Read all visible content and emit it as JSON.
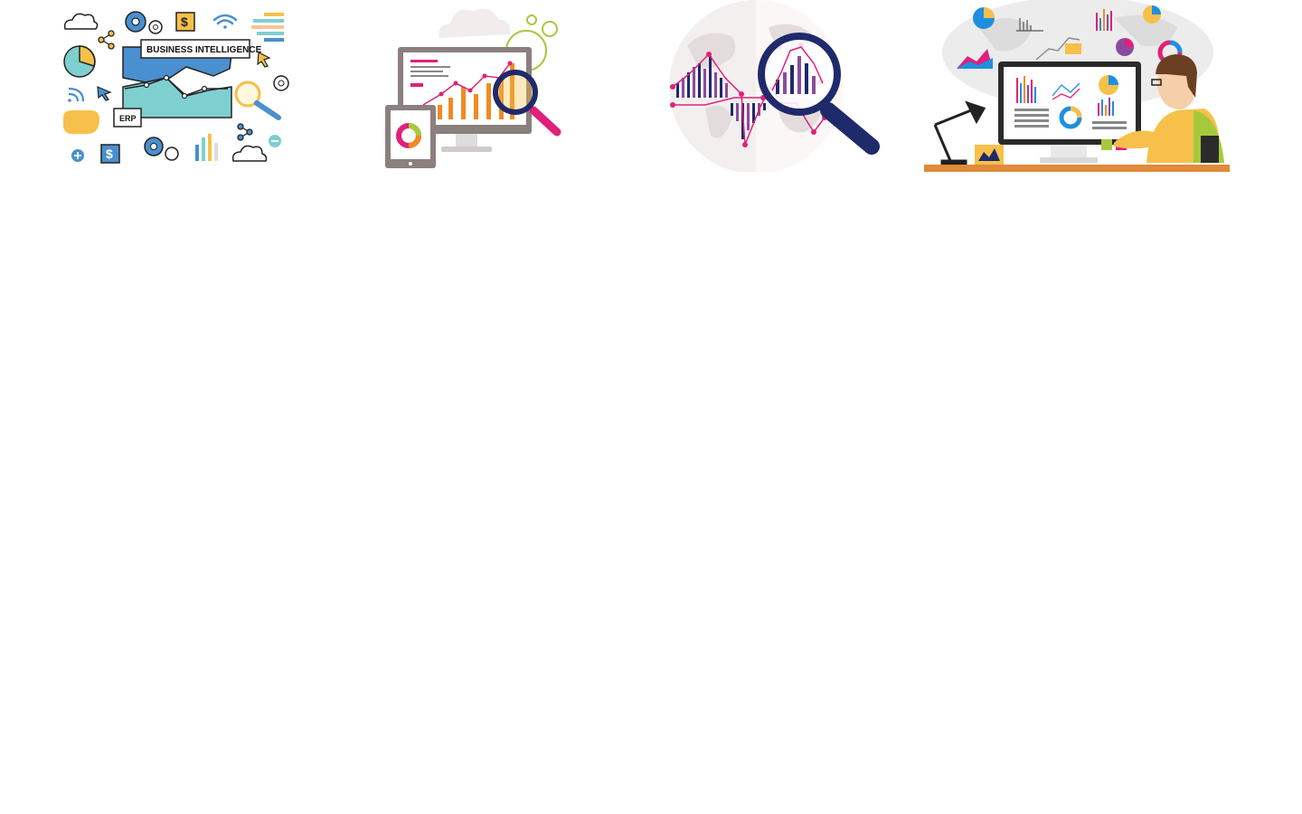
{
  "gallery": {
    "items": [
      {
        "name": "business-intelligence",
        "labels": {
          "headline": "BUSINESS INTELLIGENCE",
          "erp": "ERP",
          "currency_1": "$",
          "currency_2": "$"
        }
      },
      {
        "name": "analytics-devices"
      },
      {
        "name": "global-analysis"
      },
      {
        "name": "analyst-at-desk"
      }
    ]
  },
  "colors": {
    "blue": "#4a8fd0",
    "teal": "#7ecfd0",
    "yellow": "#f7c04a",
    "orange": "#f08a24",
    "magenta": "#e0207a",
    "navy": "#1f2a6b",
    "purple": "#8a4b9f",
    "gray": "#d9d9d9",
    "lime": "#a6c93b"
  }
}
